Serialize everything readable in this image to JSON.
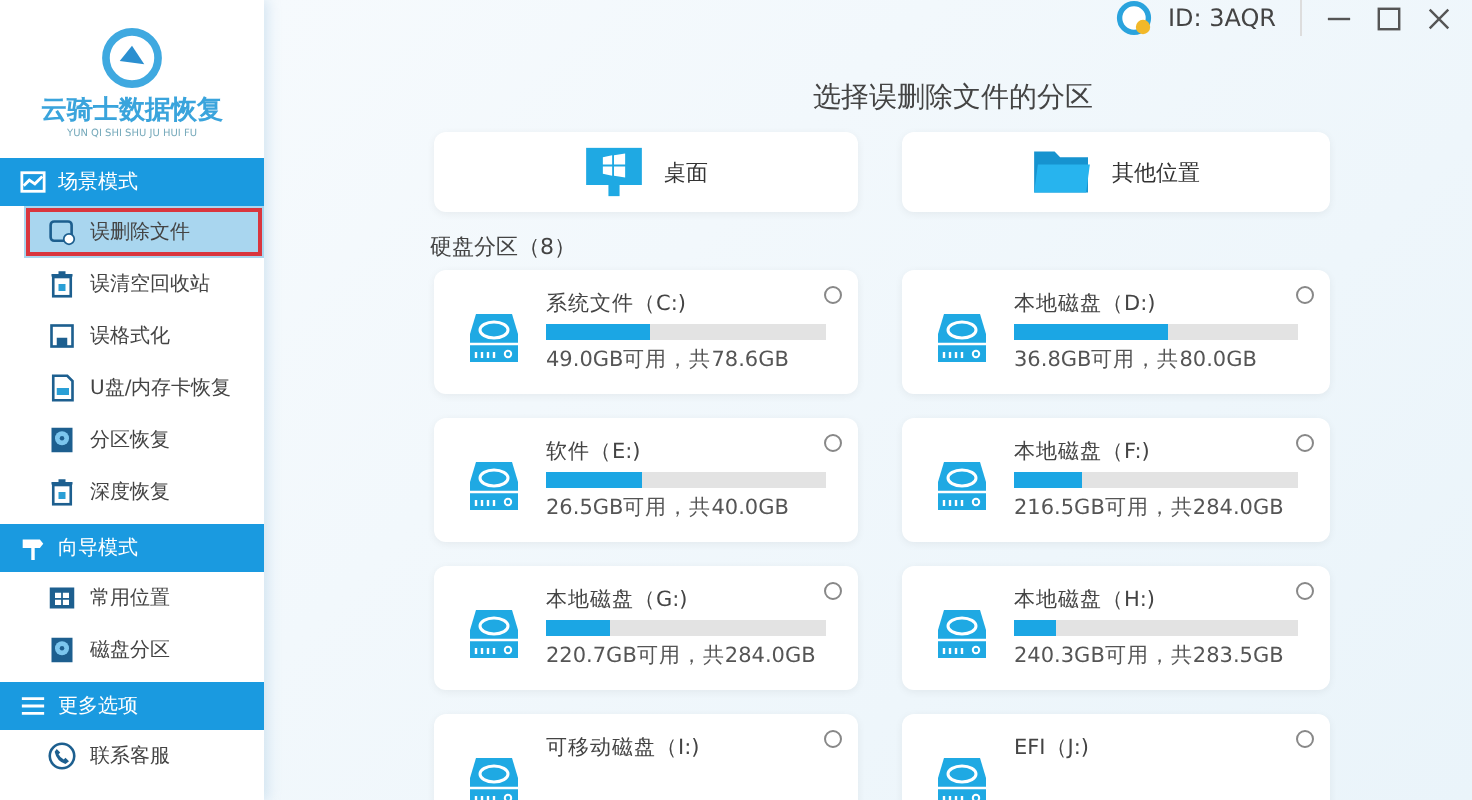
{
  "app": {
    "logo_title": "云骑士数据恢复",
    "logo_subtitle": "YUN QI SHI SHU JU HUI FU"
  },
  "sidebar": {
    "sections": [
      {
        "title": "场景模式",
        "kind": "chart",
        "items": [
          {
            "label": "误删除文件",
            "kind": "file",
            "selected": true
          },
          {
            "label": "误清空回收站",
            "kind": "bin",
            "selected": false
          },
          {
            "label": "误格式化",
            "kind": "floppy",
            "selected": false
          },
          {
            "label": "U盘/内存卡恢复",
            "kind": "card",
            "selected": false
          },
          {
            "label": "分区恢复",
            "kind": "disk",
            "selected": false
          },
          {
            "label": "深度恢复",
            "kind": "bin",
            "selected": false
          }
        ]
      },
      {
        "title": "向导模式",
        "kind": "sign",
        "items": [
          {
            "label": "常用位置",
            "kind": "windows",
            "selected": false
          },
          {
            "label": "磁盘分区",
            "kind": "disk",
            "selected": false
          }
        ]
      },
      {
        "title": "更多选项",
        "kind": "menu",
        "items": [
          {
            "label": "联系客服",
            "kind": "phone",
            "selected": false
          }
        ]
      }
    ]
  },
  "header": {
    "user_id": "ID: 3AQR"
  },
  "main": {
    "title": "选择误删除文件的分区",
    "locations": [
      {
        "label": "桌面",
        "kind": "desktop"
      },
      {
        "label": "其他位置",
        "kind": "folder"
      }
    ],
    "section_label": "硬盘分区（8）",
    "drives": [
      {
        "name": "系统文件（C:)",
        "level": 0.37,
        "reading": "49.0GB可用，共78.6GB",
        "selected": false
      },
      {
        "name": "本地磁盘（D:)",
        "level": 0.54,
        "reading": "36.8GB可用，共80.0GB",
        "selected": false
      },
      {
        "name": "软件（E:)",
        "level": 0.34,
        "reading": "26.5GB可用，共40.0GB",
        "selected": false
      },
      {
        "name": "本地磁盘（F:)",
        "level": 0.24,
        "reading": "216.5GB可用，共284.0GB",
        "selected": false
      },
      {
        "name": "本地磁盘（G:)",
        "level": 0.23,
        "reading": "220.7GB可用，共284.0GB",
        "selected": false
      },
      {
        "name": "本地磁盘（H:)",
        "level": 0.15,
        "reading": "240.3GB可用，共283.5GB",
        "selected": false
      },
      {
        "name": "可移动磁盘（I:)",
        "selected": false
      },
      {
        "name": "EFI（J:)",
        "selected": false
      }
    ]
  }
}
